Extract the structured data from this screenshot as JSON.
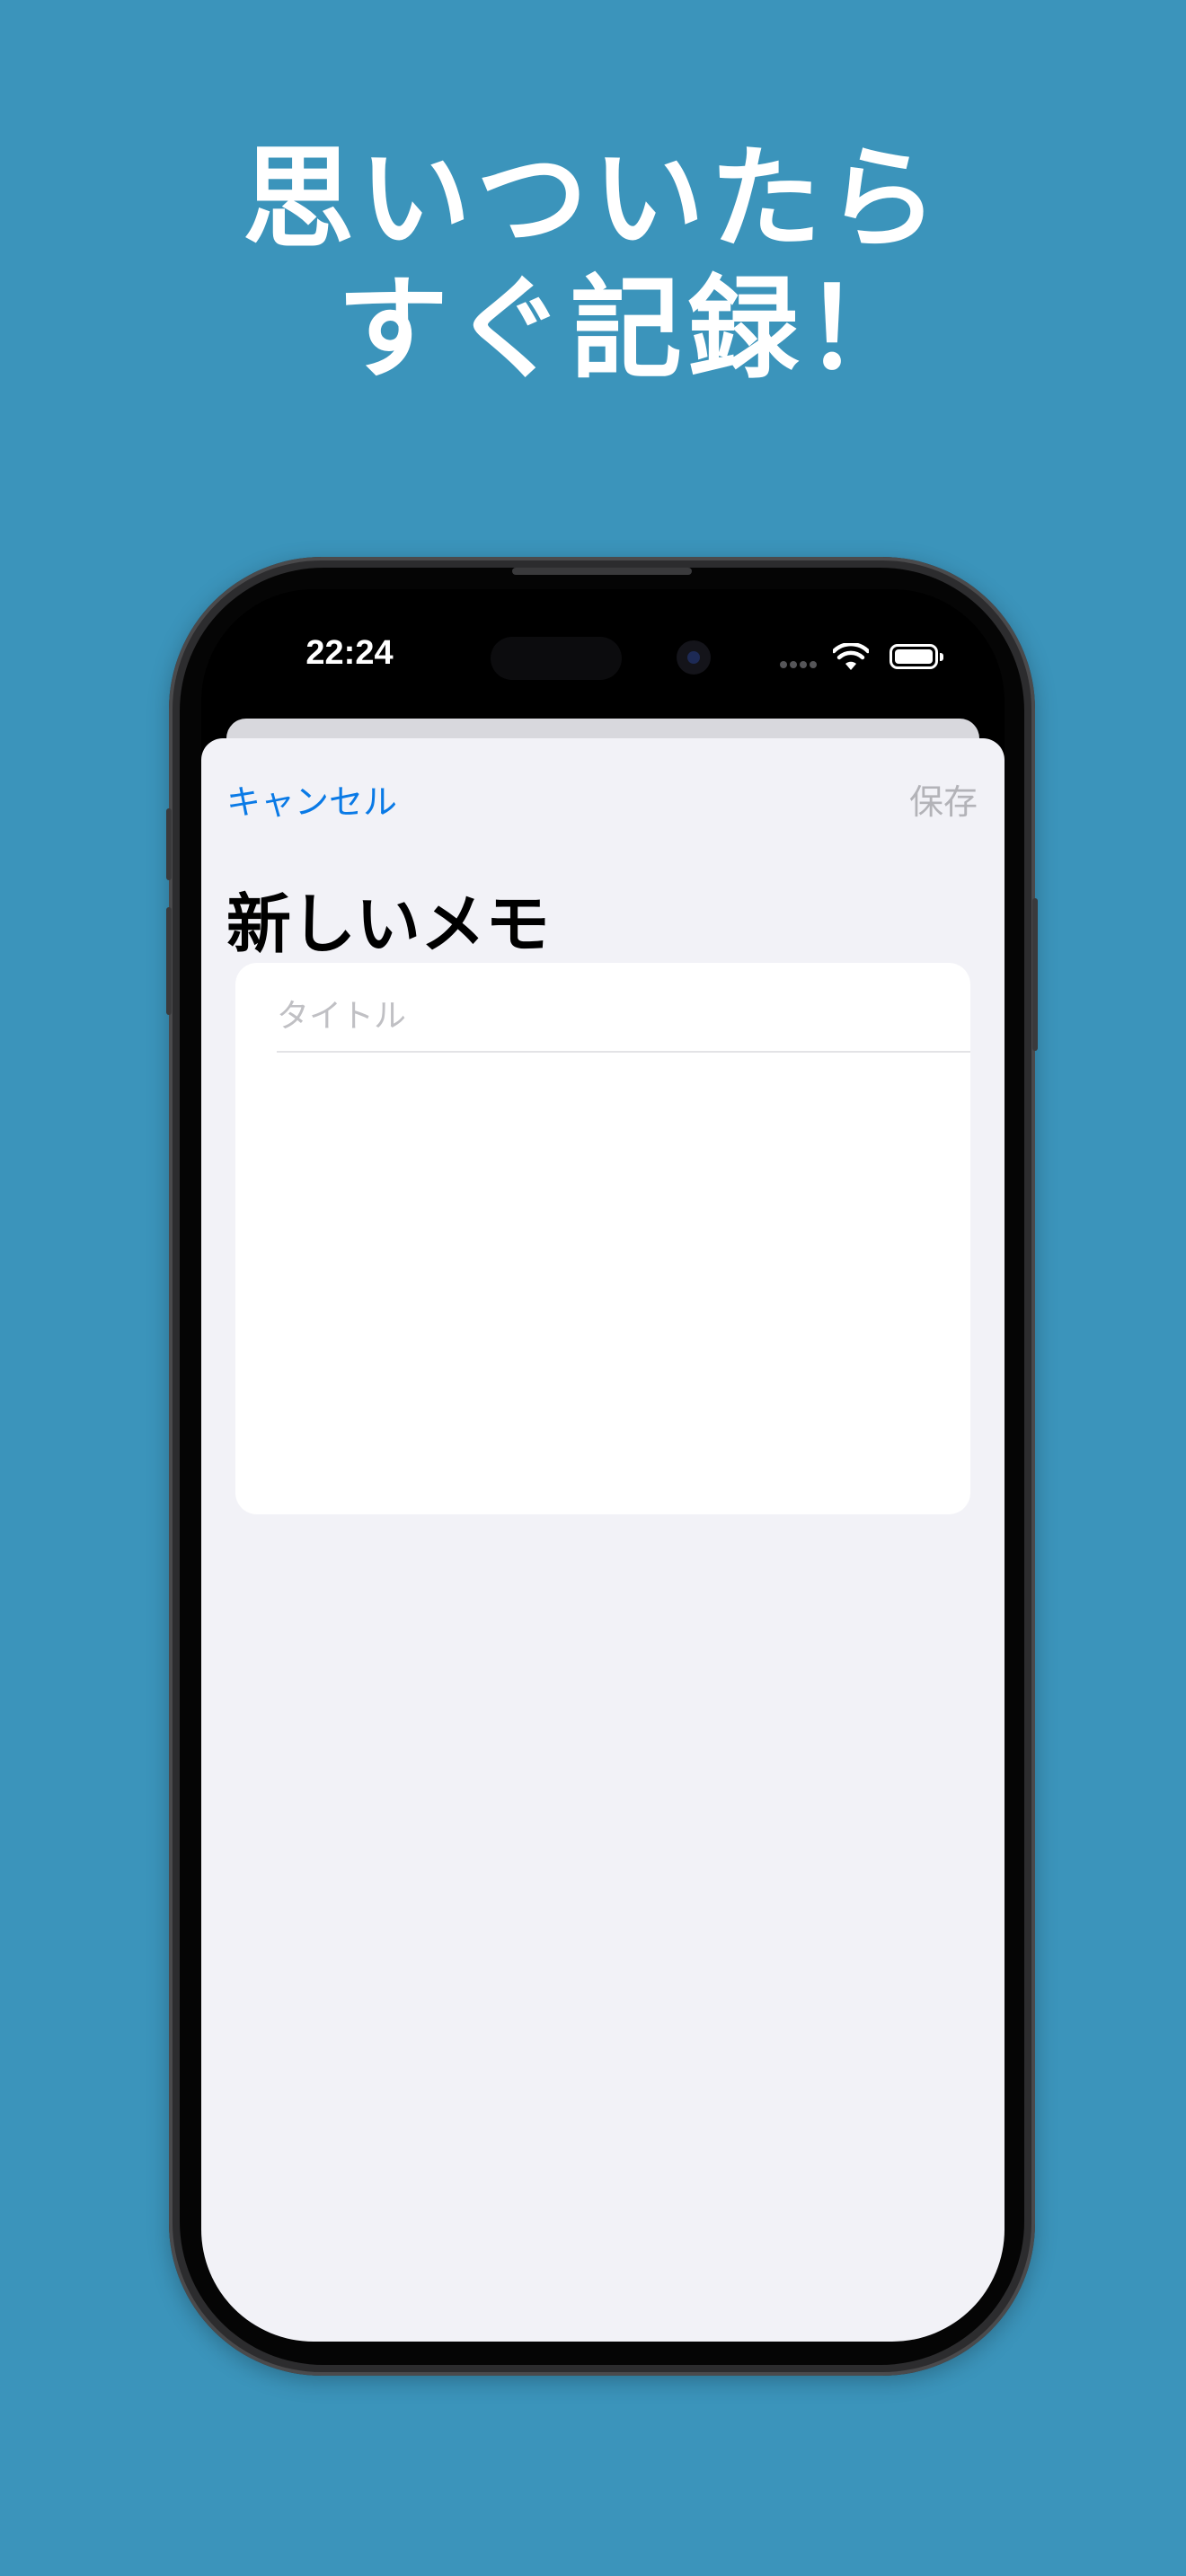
{
  "headline": {
    "line1": "思いついたら",
    "line2": "すぐ記録！"
  },
  "status_bar": {
    "time": "22:24"
  },
  "nav": {
    "cancel_label": "キャンセル",
    "save_label": "保存"
  },
  "sheet": {
    "title": "新しいメモ"
  },
  "form": {
    "title_placeholder": "タイトル",
    "title_value": "",
    "body_value": ""
  },
  "colors": {
    "background": "#3b94bb",
    "accent": "#0a7ae6",
    "disabled": "#b3b3b8",
    "sheet_background": "#f2f2f7"
  }
}
